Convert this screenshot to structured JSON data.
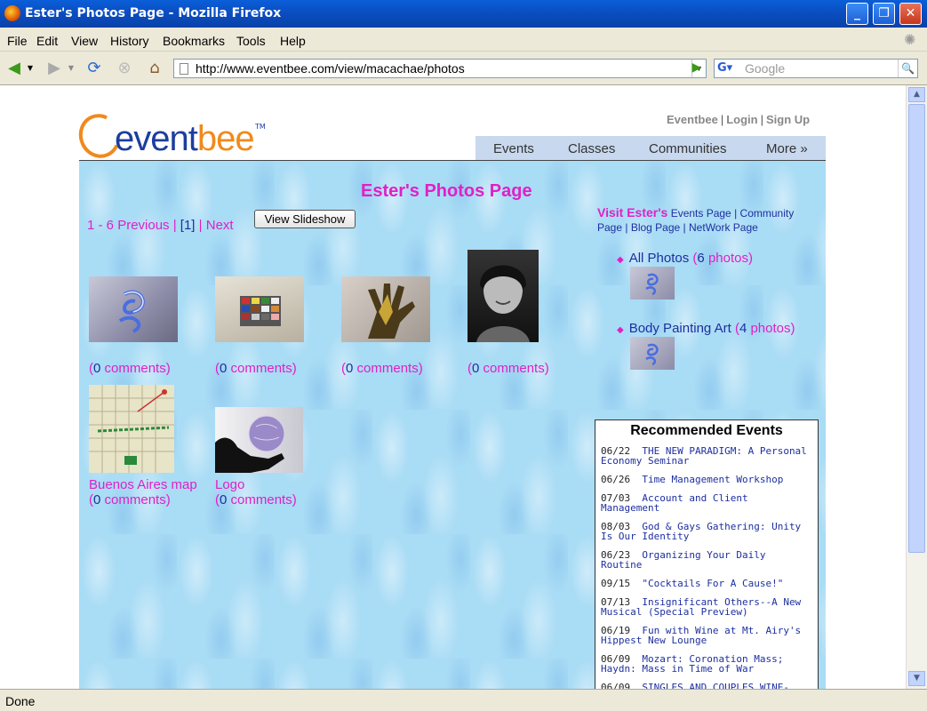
{
  "window": {
    "title": "Ester's Photos Page - Mozilla Firefox"
  },
  "menu": [
    "File",
    "Edit",
    "View",
    "History",
    "Bookmarks",
    "Tools",
    "Help"
  ],
  "toolbar": {
    "url": "http://www.eventbee.com/view/macachae/photos",
    "search_placeholder": "Google"
  },
  "status": "Done",
  "site": {
    "brand": "eventbee",
    "brand_part1": "event",
    "brand_part2": "bee",
    "tm": "TM",
    "links": [
      "Eventbee",
      "Login",
      "Sign Up"
    ],
    "nav": [
      "Events",
      "Classes",
      "Communities",
      "More »"
    ]
  },
  "page": {
    "title": "Ester's Photos Page",
    "pager": {
      "range": "1 - 6",
      "previous": "Previous",
      "current": "[1]",
      "next": "Next"
    },
    "slideshow_button": "View Slideshow",
    "photos": [
      {
        "caption": "",
        "comments": "0",
        "comments_label": "comments"
      },
      {
        "caption": "",
        "comments": "0",
        "comments_label": "comments"
      },
      {
        "caption": "",
        "comments": "0",
        "comments_label": "comments"
      },
      {
        "caption": "",
        "comments": "0",
        "comments_label": "comments"
      },
      {
        "caption": "Buenos Aires map",
        "comments": "0",
        "comments_label": "comments"
      },
      {
        "caption": "Logo",
        "comments": "0",
        "comments_label": "comments"
      }
    ]
  },
  "sidebar": {
    "visit_prefix": "Visit Ester's",
    "visit_links": [
      "Events Page",
      "Community Page",
      "Blog Page",
      "NetWork Page"
    ],
    "albums": [
      {
        "name": "All Photos",
        "count": "6",
        "unit": "photos"
      },
      {
        "name": "Body Painting Art",
        "count": "4",
        "unit": "photos"
      }
    ],
    "recommended": {
      "title": "Recommended Events",
      "events": [
        {
          "date": "06/22",
          "name": "THE NEW PARADIGM: A Personal Economy Seminar"
        },
        {
          "date": "06/26",
          "name": "Time Management Workshop"
        },
        {
          "date": "07/03",
          "name": "Account and Client Management"
        },
        {
          "date": "08/03",
          "name": "God & Gays Gathering: Unity Is Our Identity"
        },
        {
          "date": "06/23",
          "name": "Organizing Your Daily Routine"
        },
        {
          "date": "09/15",
          "name": "\"Cocktails For A Cause!\""
        },
        {
          "date": "07/13",
          "name": "Insignificant Others--A New Musical (Special Preview)"
        },
        {
          "date": "06/19",
          "name": "Fun with Wine at Mt. Airy's Hippest New Lounge"
        },
        {
          "date": "06/09",
          "name": "Mozart: Coronation Mass; Haydn: Mass in Time of War"
        },
        {
          "date": "06/09",
          "name": "SINGLES AND COUPLES WINE-TASTING, FOOD SAMPLING AND PARTY!"
        }
      ]
    }
  }
}
